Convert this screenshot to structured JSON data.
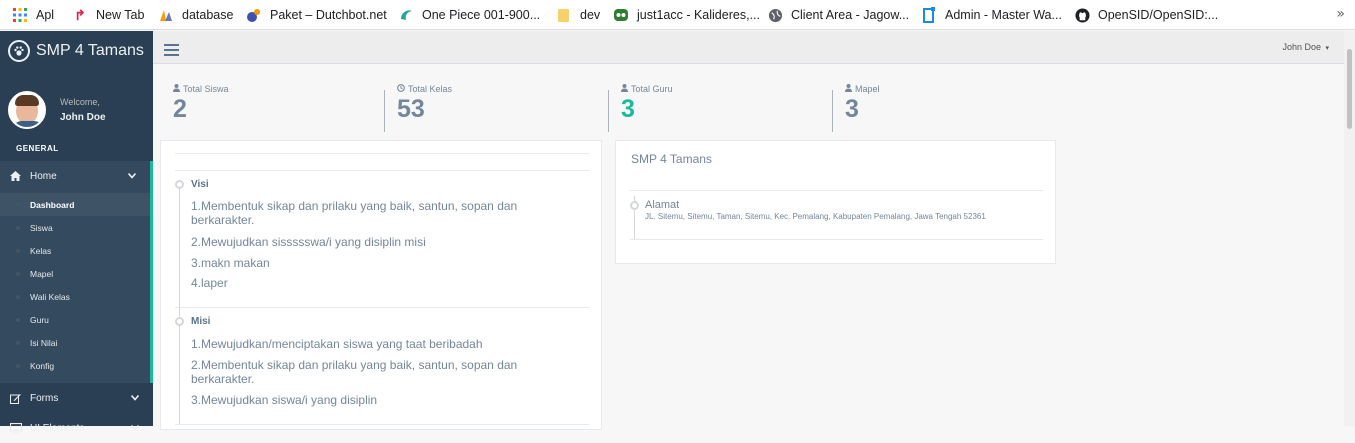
{
  "bookmarks": [
    {
      "label": "Apl",
      "icon": "apps-grid-icon",
      "color": "#4285f4"
    },
    {
      "label": "New Tab",
      "icon": "new-tab-icon",
      "color": "#d7264a"
    },
    {
      "label": "database",
      "icon": "phpmyadmin-icon",
      "color": "#f89c0e"
    },
    {
      "label": "Paket – Dutchbot.net",
      "icon": "dutchbot-icon",
      "color": "#3f51b5"
    },
    {
      "label": "One Piece 001-900...",
      "icon": "onepiece-icon",
      "color": "#26a69a"
    },
    {
      "label": "dev",
      "icon": "folder-icon",
      "color": "#f6d36a"
    },
    {
      "label": "just1acc - Kalideres,...",
      "icon": "just1acc-icon",
      "color": "#2e7d32"
    },
    {
      "label": "Client Area - Jagow...",
      "icon": "globe-icon",
      "color": "#5f6368"
    },
    {
      "label": "Admin - Master Wa...",
      "icon": "admin-icon",
      "color": "#1e88e5"
    },
    {
      "label": "OpenSID/OpenSID:...",
      "icon": "github-icon",
      "color": "#202124"
    }
  ],
  "bookmarks_more": "»",
  "sidebar": {
    "brand": "SMP 4 Tamans",
    "welcome": "Welcome,",
    "username": "John Doe",
    "section": "GENERAL",
    "home_label": "Home",
    "submenu": [
      "Dashboard",
      "Siswa",
      "Kelas",
      "Mapel",
      "Wali Kelas",
      "Guru",
      "Isi Nilai",
      "Konfig"
    ],
    "forms_label": "Forms",
    "ui_label": "UI Elements"
  },
  "topnav": {
    "user": "John Doe",
    "caret": "▾"
  },
  "tiles": [
    {
      "label": "Total Siswa",
      "icon": "user-icon",
      "value": "2",
      "accent": false
    },
    {
      "label": "Total Kelas",
      "icon": "clock-icon",
      "value": "53",
      "accent": false
    },
    {
      "label": "Total Guru",
      "icon": "user-icon",
      "value": "3",
      "accent": true
    },
    {
      "label": "Mapel",
      "icon": "user-icon",
      "value": "3",
      "accent": false
    }
  ],
  "visi_misi": {
    "visi_title": "Visi",
    "visi": [
      "1.Membentuk sikap dan prilaku yang baik, santun, sopan dan berkarakter.",
      "2.Mewujudkan sissssswa/i yang disiplin misi",
      "3.makn makan",
      "4.laper"
    ],
    "misi_title": "Misi",
    "misi": [
      "1.Mewujudkan/menciptakan siswa yang taat beribadah",
      "2.Membentuk sikap dan prilaku yang baik, santun, sopan dan berkarakter.",
      "3.Mewujudkan siswa/i yang disiplin"
    ]
  },
  "school": {
    "title": "SMP 4 Tamans",
    "address_label": "Alamat",
    "address": "JL. Sitemu, Sitemu, Taman, Sitemu, Kec. Pemalang, Kabupaten Pemalang, Jawa Tengah 52361"
  },
  "colors": {
    "sidebar": "#2a3f54",
    "accent": "#1abb9c",
    "text_muted": "#73879c"
  }
}
